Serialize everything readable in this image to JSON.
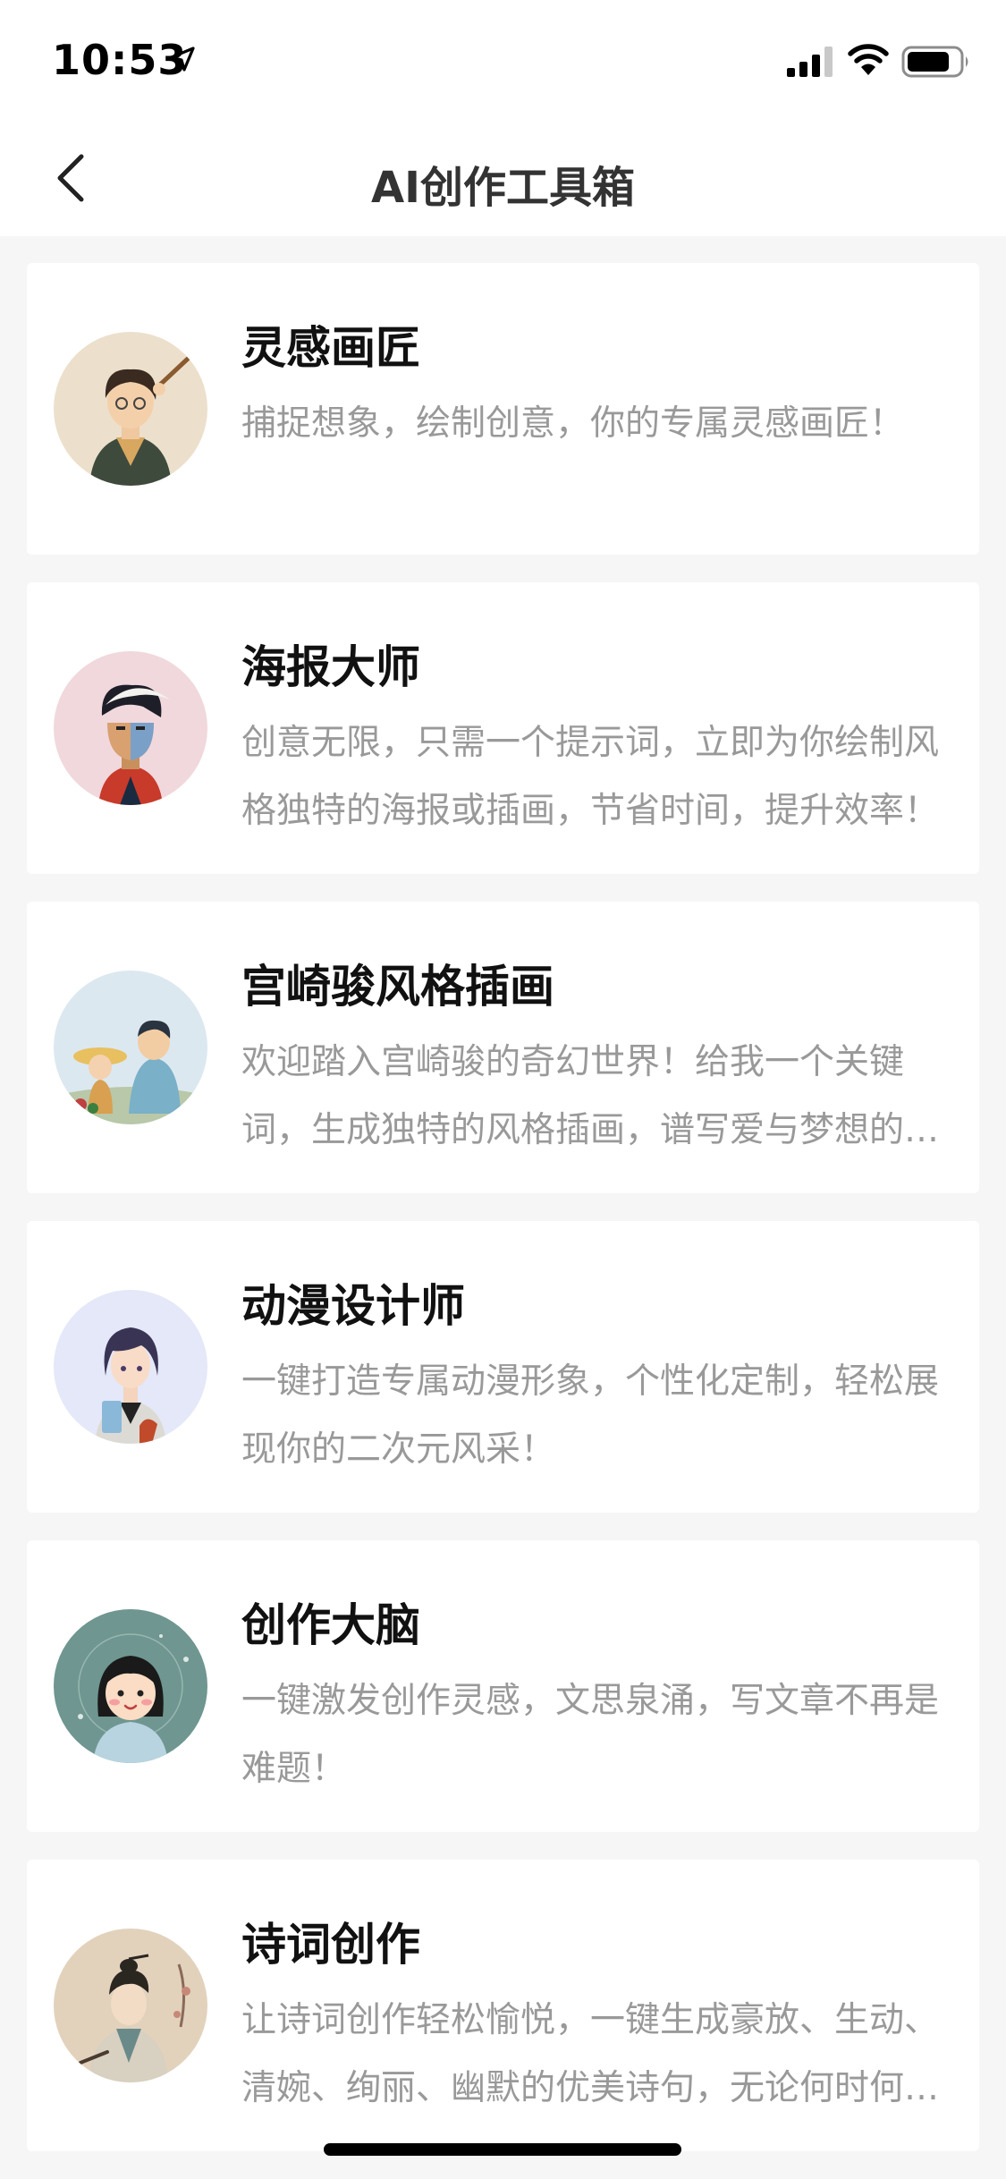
{
  "status_bar": {
    "time": "10:53",
    "icons": [
      "location-arrow-icon",
      "signal-icon",
      "wifi-icon",
      "battery-icon"
    ]
  },
  "nav": {
    "title": "AI创作工具箱",
    "back_icon": "chevron-left-icon"
  },
  "tools": [
    {
      "name": "灵感画匠",
      "description": "捕捉想象，绘制创意，你的专属灵感画匠！",
      "avatar_icon": "painter-boy-avatar",
      "avatar_bg": "#ece0cc"
    },
    {
      "name": "海报大师",
      "description": "创意无限，只需一个提示词，立即为你绘制风格独特的海报或插画，节省时间，提升效率！",
      "avatar_icon": "poster-man-avatar",
      "avatar_bg": "#f0d8dc"
    },
    {
      "name": "宫崎骏风格插画",
      "description": "欢迎踏入宫崎骏的奇幻世界！给我一个关键词，生成独特的风格插画，谱写爱与梦想的故事！",
      "avatar_icon": "ghibli-kids-avatar",
      "avatar_bg": "#dce8f0"
    },
    {
      "name": "动漫设计师",
      "description": "一键打造专属动漫形象，个性化定制，轻松展现你的二次元风采！",
      "avatar_icon": "anime-girl-avatar",
      "avatar_bg": "#e4e8f8"
    },
    {
      "name": "创作大脑",
      "description": "一键激发创作灵感，文思泉涌，写文章不再是难题！",
      "avatar_icon": "girl-writer-avatar",
      "avatar_bg": "#6f9690"
    },
    {
      "name": "诗词创作",
      "description": "让诗词创作轻松愉悦，一键生成豪放、生动、清婉、绚丽、幽默的优美诗句，无论何时何地都能挥毫泼墨！",
      "avatar_icon": "ancient-poet-avatar",
      "avatar_bg": "#e2d2bc"
    }
  ]
}
